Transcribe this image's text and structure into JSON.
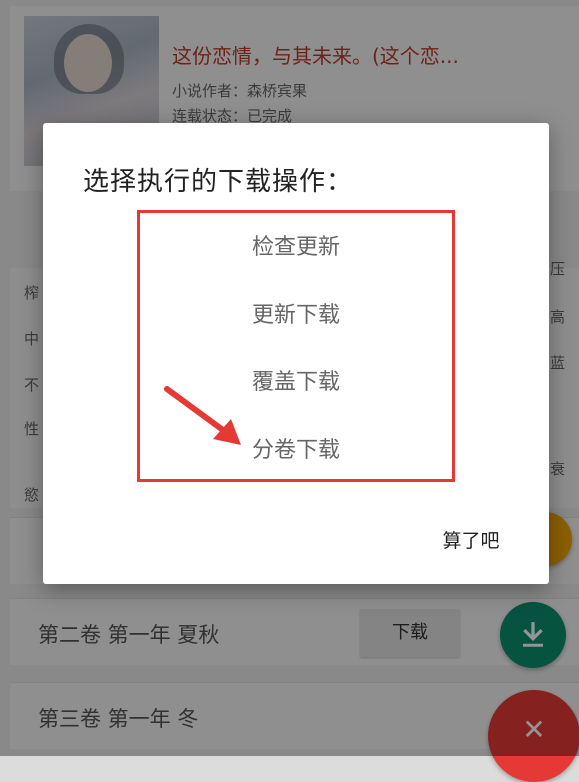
{
  "book": {
    "title": "这份恋情，与其未来。(这个恋...",
    "author": "小说作者：森桥宾果",
    "status": "连载状态：已完成"
  },
  "background_fragments": {
    "left": [
      "榨",
      "中",
      "不",
      "性",
      "慾"
    ],
    "right": [
      "压",
      "高",
      "蓝",
      "衰"
    ]
  },
  "volumes": [
    {
      "label": ""
    },
    {
      "label": "第二卷 第一年 夏秋"
    },
    {
      "label": "第三卷 第一年 冬"
    }
  ],
  "download_button_label": "下载",
  "fab": {
    "download_icon": "download-icon",
    "close_icon": "close-icon",
    "close_glyph": "✕"
  },
  "dialog": {
    "title": "选择执行的下载操作：",
    "options": [
      "检查更新",
      "更新下载",
      "覆盖下载",
      "分卷下载"
    ],
    "cancel_label": "算了吧"
  },
  "colors": {
    "accent_red": "#e53935",
    "fab_green": "#0b8f6e",
    "fab_orange": "#f0a500",
    "title_red": "#c0392b"
  }
}
